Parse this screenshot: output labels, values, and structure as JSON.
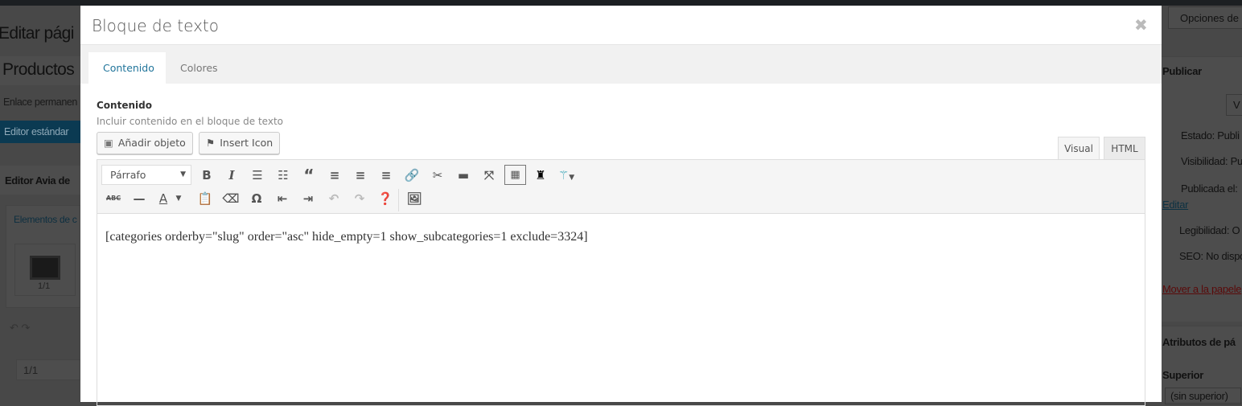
{
  "background": {
    "page_title": "Editar pági",
    "screen_options": "Opciones de",
    "post_title": "Productos",
    "permalink": "Enlace permanen",
    "standard_editor": "Editor estándar",
    "avia_editor": "Editor Avia de",
    "elements_label": "Elementos de c",
    "element_1": "1/1",
    "row_label": "1/1",
    "publish": {
      "title": "Publicar",
      "view_btn": "V",
      "status": "Estado: Publi",
      "visibility": "Visibilidad: Pu",
      "published": "Publicada el:",
      "edit": "Editar",
      "readability": "Legibilidad: O",
      "seo": "SEO: No dispo",
      "trash": "Mover a la papele"
    },
    "attributes": {
      "title": "Atributos de pá",
      "parent": "Superior",
      "parent_value": "(sin superior)"
    }
  },
  "modal": {
    "title": "Bloque de texto",
    "close": "✖",
    "tabs": [
      {
        "label": "Contenido",
        "active": true
      },
      {
        "label": "Colores",
        "active": false
      }
    ],
    "field_label": "Contenido",
    "field_desc": "Incluir contenido en el bloque de texto",
    "add_media": "Añadir objeto",
    "insert_icon": "Insert Icon",
    "editor_tabs": [
      "Visual",
      "HTML"
    ],
    "format_select": "Párrafo",
    "content": "[categories orderby=\"slug\" order=\"asc\" hide_empty=1 show_subcategories=1 exclude=3324]",
    "accent": "#21759b"
  }
}
